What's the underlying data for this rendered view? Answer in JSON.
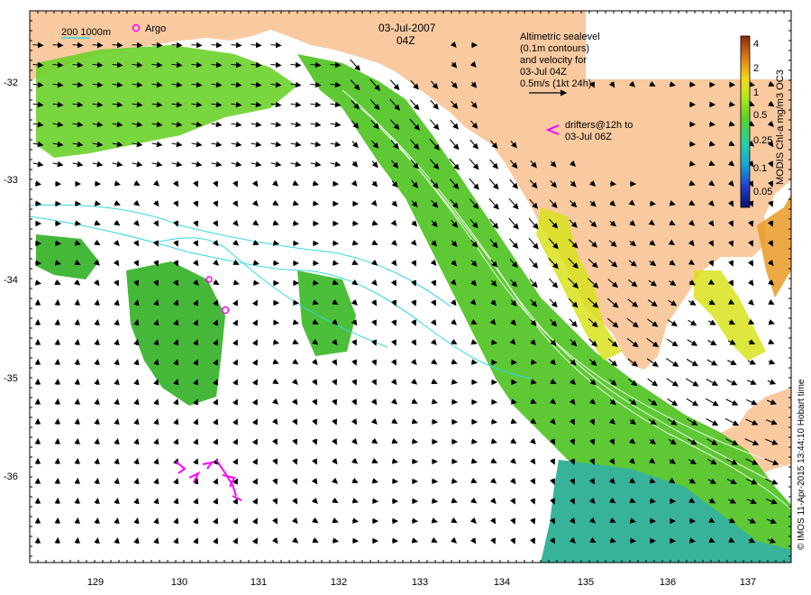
{
  "map": {
    "date": "03-Jul-2007",
    "time": "04Z",
    "scale_label": "200  1000m",
    "argo_label": "Argo",
    "altimetry_note": [
      "Altimetric sealevel",
      "(0.1m contours)",
      "and velocity for",
      "03-Jul 04Z",
      "0.5m/s (1kt 24h)"
    ],
    "drifter_note": [
      "drifters@12h to",
      "03-Jul 06Z"
    ],
    "colorbar": {
      "title": "MODIS Chl-a mg/m3 OC3",
      "ticks": [
        "4",
        "2",
        "1",
        "0.5",
        "0.25",
        "0.1",
        "0.05"
      ]
    },
    "credit": "© IMOS 11-Apr-2015 13:44:10 Hobart time",
    "x_ticks": [
      "129",
      "130",
      "131",
      "132",
      "133",
      "134",
      "135",
      "136",
      "137"
    ],
    "y_ticks": [
      "-32",
      "-33",
      "-34",
      "-35",
      "-36"
    ],
    "colors": {
      "land": "#f9c9a0",
      "chl_green": "#55c52a",
      "chl_teal": "#37b39a",
      "chl_yellow": "#d9e21c",
      "contour_cyan": "#32d6e6",
      "drifter": "#ff00ff"
    }
  }
}
